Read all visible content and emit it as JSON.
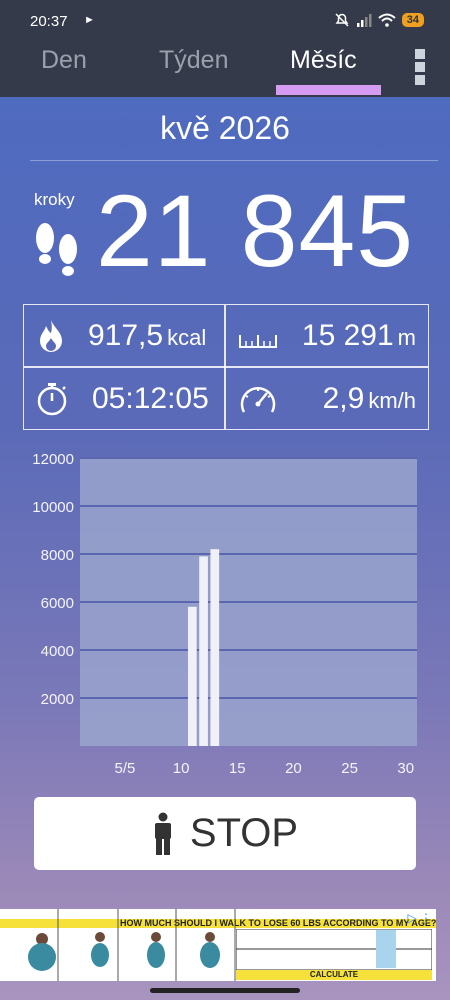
{
  "status_bar": {
    "time": "20:37",
    "battery": "34"
  },
  "tabs": [
    {
      "label": "Den"
    },
    {
      "label": "Týden"
    },
    {
      "label": "Měsíc"
    }
  ],
  "period": "kvě 2026",
  "steps": {
    "label": "kroky",
    "value": "21 845"
  },
  "stats": {
    "calories": {
      "value": "917,5",
      "unit": "kcal"
    },
    "distance": {
      "value": "15 291",
      "unit": "m"
    },
    "duration": {
      "value": "05:12:05"
    },
    "speed": {
      "value": "2,9",
      "unit": "km/h"
    }
  },
  "chart_data": {
    "type": "bar",
    "x": [
      11,
      12,
      13
    ],
    "values": [
      5800,
      7900,
      8200
    ],
    "xlim": [
      1,
      31
    ],
    "ylim": [
      0,
      12000
    ],
    "x_ticks": [
      "5/5",
      "10",
      "15",
      "20",
      "25",
      "30"
    ],
    "y_ticks": [
      "2000",
      "4000",
      "6000",
      "8000",
      "10000",
      "12000"
    ],
    "grid": true
  },
  "stop_button": {
    "label": "STOP"
  },
  "ad": {
    "title": "HOW MUCH SHOULD I WALK TO LOSE 60 LBS ACCORDING TO MY AGE?",
    "cta": "CALCULATE"
  },
  "colors": {
    "accent": "#d69cf2",
    "bar": "#f0f0f8",
    "plot_bg": "#9aa4cc"
  }
}
